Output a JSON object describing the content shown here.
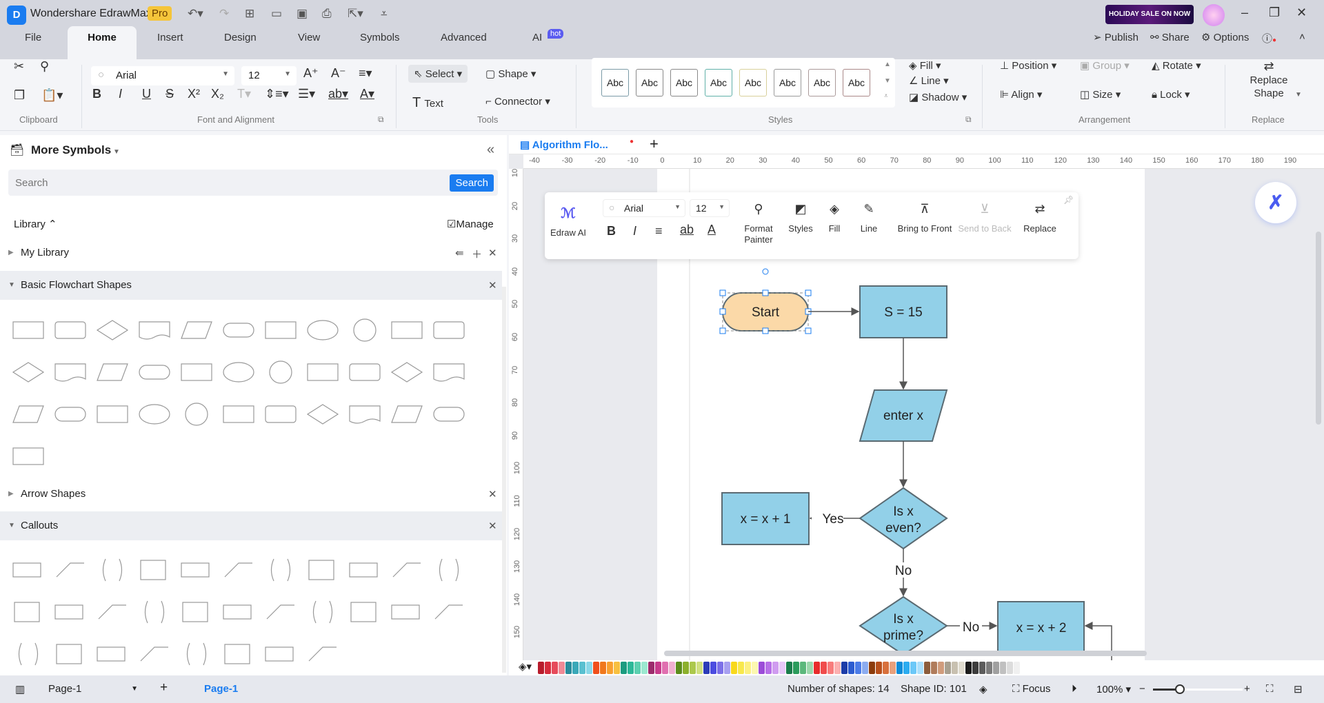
{
  "app": {
    "title": "Wondershare EdrawMax",
    "badge": "Pro",
    "sale": "HOLIDAY SALE ON NOW"
  },
  "menu_tabs": [
    "File",
    "Home",
    "Insert",
    "Design",
    "View",
    "Symbols",
    "Advanced",
    "AI"
  ],
  "ai_badge": "hot",
  "top_right": {
    "publish": "Publish",
    "share": "Share",
    "options": "Options"
  },
  "ribbon": {
    "font": "Arial",
    "size": "12",
    "groups": {
      "clipboard": "Clipboard",
      "font": "Font and Alignment",
      "tools": "Tools",
      "styles": "Styles",
      "arrangement": "Arrangement",
      "replace": "Replace"
    },
    "tools": {
      "select": "Select",
      "shape": "Shape",
      "text": "Text",
      "connector": "Connector"
    },
    "style_swatches": [
      "Abc",
      "Abc",
      "Abc",
      "Abc",
      "Abc",
      "Abc",
      "Abc",
      "Abc"
    ],
    "style_colors": [
      "#7a9aa6",
      "#888",
      "#888",
      "#5fb0a8",
      "#d8d09a",
      "#999",
      "#a99",
      "#a88"
    ],
    "fill": "Fill",
    "line": "Line",
    "shadow": "Shadow",
    "arrangement": {
      "position": "Position",
      "group": "Group",
      "rotate": "Rotate",
      "align": "Align",
      "size": "Size",
      "lock": "Lock"
    },
    "replace_shape": "Replace Shape"
  },
  "left_panel": {
    "title": "More Symbols",
    "search_placeholder": "Search",
    "search_button": "Search",
    "library": "Library",
    "manage": "Manage",
    "sections": [
      {
        "label": "My Library"
      },
      {
        "label": "Basic Flowchart Shapes"
      },
      {
        "label": "Arrow Shapes"
      },
      {
        "label": "Callouts"
      }
    ]
  },
  "document": {
    "tab": "Algorithm Flo..."
  },
  "ruler": {
    "h": [
      "-40",
      "-30",
      "-20",
      "-10",
      "0",
      "10",
      "20",
      "30",
      "40",
      "50",
      "60",
      "70",
      "80",
      "90",
      "100",
      "110",
      "120",
      "130",
      "140",
      "150",
      "160",
      "170",
      "180",
      "190"
    ],
    "v": [
      "10",
      "20",
      "30",
      "40",
      "50",
      "60",
      "70",
      "80",
      "90",
      "100",
      "110",
      "120",
      "130",
      "140",
      "150"
    ]
  },
  "float_toolbar": {
    "edraw_ai": "Edraw AI",
    "font": "Arial",
    "size": "12",
    "format_painter": "Format Painter",
    "styles": "Styles",
    "fill": "Fill",
    "line": "Line",
    "bring_front": "Bring to Front",
    "send_back": "Send to Back",
    "replace": "Replace"
  },
  "flowchart": {
    "start": "Start",
    "s15": "S = 15",
    "enter": "enter x",
    "inc1": "x = x + 1",
    "even": [
      "Is x",
      "even?"
    ],
    "yes": "Yes",
    "no1": "No",
    "prime": [
      "Is x",
      "prime?"
    ],
    "no2": "No",
    "inc2": "x = x + 2",
    "colors": {
      "process": "#92d0e8",
      "start": "#fbd9a8",
      "stroke": "#5a6a72"
    }
  },
  "palette": [
    "#b81c2c",
    "#d62c3c",
    "#e64b5b",
    "#f08a96",
    "#2a8c9c",
    "#3aa8b8",
    "#5ac0d0",
    "#8ad8e8",
    "#f0501c",
    "#f0781c",
    "#f8a030",
    "#f8c040",
    "#1c9c80",
    "#2cb898",
    "#5cd0b0",
    "#9ce8d0",
    "#9c2c6c",
    "#c83c8c",
    "#e070b0",
    "#f0b0d0",
    "#5c8c1c",
    "#8cb02c",
    "#acc84c",
    "#d0e080",
    "#2c3cb8",
    "#4c4ce0",
    "#7c70e8",
    "#a8a0f0",
    "#f8d81c",
    "#f8e84c",
    "#fcf080",
    "#fcf8b0",
    "#9c4cd8",
    "#b870e8",
    "#d09cf0",
    "#e8c8f8",
    "#1c7c4c",
    "#2c9c5c",
    "#5cb87c",
    "#9cd8ac",
    "#e82c2c",
    "#f04c4c",
    "#f87c7c",
    "#fcb0b0",
    "#1c3ca8",
    "#2c5cd0",
    "#4c7ce8",
    "#8cacf0",
    "#8c3c0c",
    "#b8501c",
    "#d8703c",
    "#e8a07c",
    "#0c8cd8",
    "#2cacf0",
    "#6cc8f8",
    "#ace0fc",
    "#8c5c3c",
    "#b07c5c",
    "#d09c7c",
    "#a8a090",
    "#c8c0b0",
    "#e0dcd0",
    "#1c1c1c",
    "#3c3c3c",
    "#5c5c5c",
    "#7c7c7c",
    "#a0a0a0",
    "#c0c0c0",
    "#dcdcdc",
    "#f0f0f0"
  ],
  "status": {
    "page_sel": "Page-1",
    "page_tab": "Page-1",
    "shapes": "Number of shapes: 14",
    "shape_id": "Shape ID: 101",
    "focus": "Focus",
    "zoom": "100%",
    "zoom_level": 0.3
  }
}
